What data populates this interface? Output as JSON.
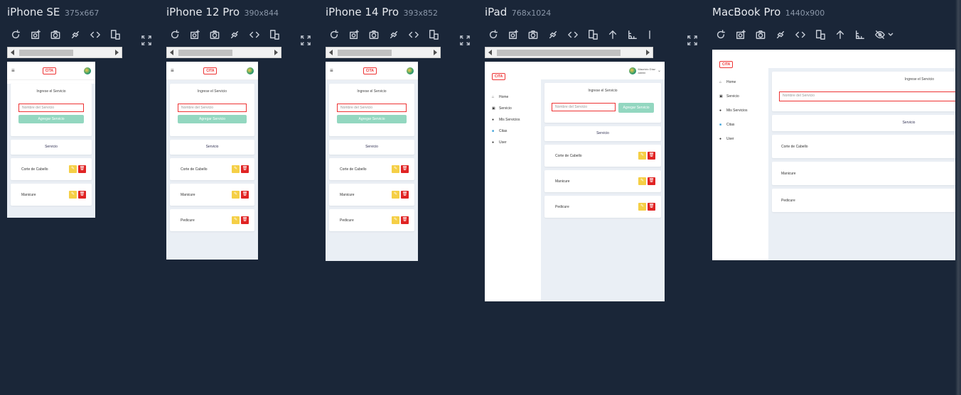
{
  "devices": [
    {
      "name": "iPhone SE",
      "size": "375x667"
    },
    {
      "name": "iPhone 12 Pro",
      "size": "390x844"
    },
    {
      "name": "iPhone 14 Pro",
      "size": "393x852"
    },
    {
      "name": "iPad",
      "size": "768x1024"
    },
    {
      "name": "MacBook Pro",
      "size": "1440x900"
    }
  ],
  "app": {
    "logo": "CITA",
    "hamburger": "≡",
    "card_title": "Ingrese el Servicio",
    "input_placeholder": "Nombre del Servicio",
    "add_button": "Agregar Servicio",
    "services_header": "Servicio",
    "services": [
      "Corte de Cabello",
      "Manicure",
      "Pedicure"
    ],
    "edit_glyph": "✎",
    "delete_glyph": "🗑",
    "user_name": "Mauricio Díaz",
    "user_role": "admin",
    "sidebar": [
      {
        "label": "Home",
        "icon": "home-icon"
      },
      {
        "label": "Servicio",
        "icon": "camera-icon"
      },
      {
        "label": "Mis Servicios",
        "icon": "user-icon"
      },
      {
        "label": "Citas",
        "icon": "bullet-icon"
      },
      {
        "label": "User",
        "icon": "user-icon"
      }
    ]
  }
}
